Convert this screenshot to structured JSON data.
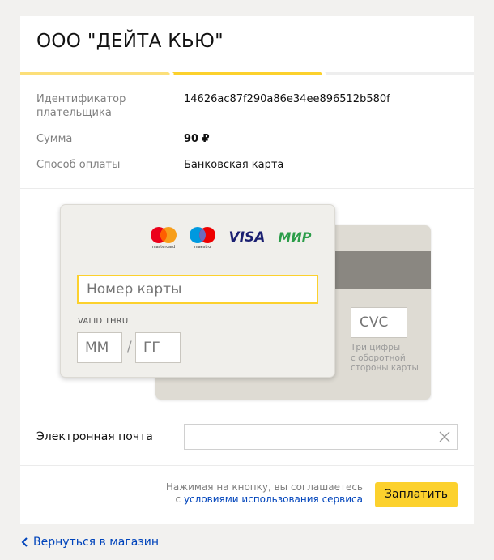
{
  "merchant": {
    "name": "ООО \"ДЕЙТА КЬЮ\""
  },
  "progress": {
    "steps_total": 3,
    "current_step": 2
  },
  "payment_info": {
    "payer_id_label": "Идентификатор плательщика",
    "payer_id_label_line1": "Идентификатор",
    "payer_id_label_line2": "плательщика",
    "payer_id_value": "14626ac87f290a86e34ee896512b580f",
    "amount_label": "Сумма",
    "amount_value": "90 ₽",
    "method_label": "Способ оплаты",
    "method_value": "Банковская карта"
  },
  "card_form": {
    "logos": [
      "mastercard-icon",
      "maestro-icon",
      "visa-icon",
      "mir-icon"
    ],
    "mastercard_text": "mastercard",
    "maestro_text": "maestro",
    "visa_text": "VISA",
    "mir_text": "МИР",
    "card_number_placeholder": "Номер карты",
    "valid_thru_label": "VALID THRU",
    "month_placeholder": "ММ",
    "separator": "/",
    "year_placeholder": "ГГ",
    "cvc_placeholder": "CVC",
    "cvc_hint": "Три цифры с оборотной стороны карты",
    "cvc_hint_line1": "Три цифры",
    "cvc_hint_line2": "с оборотной",
    "cvc_hint_line3": "стороны карты"
  },
  "email": {
    "label": "Электронная почта",
    "value": ""
  },
  "footer": {
    "terms_line1": "Нажимая на кнопку, вы соглашаетесь",
    "terms_prefix": "с",
    "terms_link": "условиями использования сервиса",
    "pay_button": "Заплатить"
  },
  "back_link": "Вернуться в магазин",
  "colors": {
    "accent_yellow": "#fcd12d",
    "link_blue": "#0044bb",
    "background": "#f2f1ef"
  }
}
